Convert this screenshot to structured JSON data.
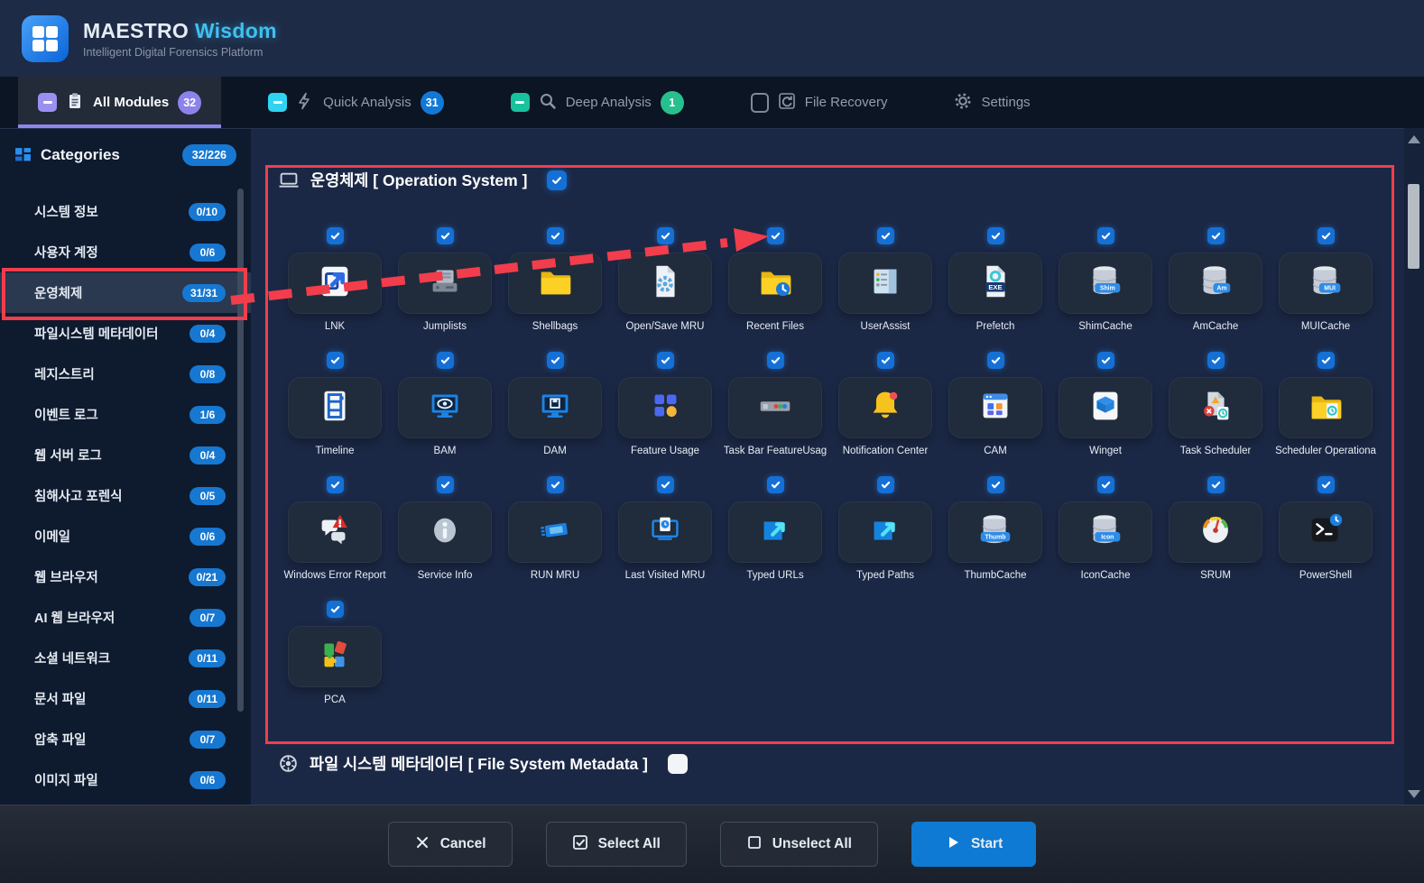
{
  "header": {
    "title_primary": "MAESTRO",
    "title_accent": "Wisdom",
    "subtitle": "Intelligent Digital Forensics Platform",
    "logo_icon": "grid-logo-icon"
  },
  "tabs": [
    {
      "label": "All Modules",
      "badge": "32",
      "badge_color": "#8d82ea",
      "state": "indeterminate",
      "state_color": "#9c8ff2",
      "icon": "clipboard-icon",
      "active": true
    },
    {
      "label": "Quick Analysis",
      "badge": "31",
      "badge_color": "#1278d8",
      "state": "indeterminate",
      "state_color": "#2fd4f2",
      "icon": "lightning-icon",
      "active": false
    },
    {
      "label": "Deep Analysis",
      "badge": "1",
      "badge_color": "#28bf8e",
      "state": "indeterminate",
      "state_color": "#19c29e",
      "icon": "search-icon",
      "active": false
    },
    {
      "label": "File Recovery",
      "badge": null,
      "state": "unchecked",
      "state_color": "#7e8a9c",
      "icon": "recovery-icon",
      "active": false
    },
    {
      "label": "Settings",
      "badge": null,
      "state": null,
      "state_color": null,
      "icon": "gear-icon",
      "active": false
    }
  ],
  "sidebar": {
    "title": "Categories",
    "badge": "32/226",
    "icon": "categories-grid-icon",
    "items": [
      {
        "label": "시스템 정보",
        "badge": "0/10",
        "selected": false
      },
      {
        "label": "사용자 계정",
        "badge": "0/6",
        "selected": false
      },
      {
        "label": "운영체제",
        "badge": "31/31",
        "selected": true
      },
      {
        "label": "파일시스템 메타데이터",
        "badge": "0/4",
        "selected": false
      },
      {
        "label": "레지스트리",
        "badge": "0/8",
        "selected": false
      },
      {
        "label": "이벤트 로그",
        "badge": "1/6",
        "selected": false
      },
      {
        "label": "웹 서버 로그",
        "badge": "0/4",
        "selected": false
      },
      {
        "label": "침해사고 포렌식",
        "badge": "0/5",
        "selected": false
      },
      {
        "label": "이메일",
        "badge": "0/6",
        "selected": false
      },
      {
        "label": "웹 브라우저",
        "badge": "0/21",
        "selected": false
      },
      {
        "label": "AI 웹 브라우저",
        "badge": "0/7",
        "selected": false
      },
      {
        "label": "소셜 네트워크",
        "badge": "0/11",
        "selected": false
      },
      {
        "label": "문서 파일",
        "badge": "0/11",
        "selected": false
      },
      {
        "label": "압축 파일",
        "badge": "0/7",
        "selected": false
      },
      {
        "label": "이미지 파일",
        "badge": "0/6",
        "selected": false
      }
    ]
  },
  "main": {
    "sections": [
      {
        "title": "운영체제 [ Operation System ]",
        "icon": "laptop-icon",
        "checked": true
      },
      {
        "title": "파일 시스템 메타데이터 [ File System Metadata ]",
        "icon": "metadata-gear-icon",
        "checked": false
      }
    ],
    "modules": [
      {
        "label": "LNK",
        "icon": "lnk-icon",
        "checked": true
      },
      {
        "label": "Jumplists",
        "icon": "drive-icon",
        "checked": true
      },
      {
        "label": "Shellbags",
        "icon": "folder-icon",
        "checked": true
      },
      {
        "label": "Open/Save MRU",
        "icon": "file-gear-icon",
        "checked": true
      },
      {
        "label": "Recent Files",
        "icon": "folder-clock-icon",
        "checked": true
      },
      {
        "label": "UserAssist",
        "icon": "list-window-icon",
        "checked": true
      },
      {
        "label": "Prefetch",
        "icon": "file-exe-icon",
        "checked": true
      },
      {
        "label": "ShimCache",
        "icon": "database-icon",
        "badge": "Shim",
        "checked": true
      },
      {
        "label": "AmCache",
        "icon": "database-icon",
        "badge": "Am",
        "checked": true
      },
      {
        "label": "MUICache",
        "icon": "database-icon",
        "badge": "MUI",
        "checked": true
      },
      {
        "label": "Timeline",
        "icon": "filmstrip-icon",
        "checked": true
      },
      {
        "label": "BAM",
        "icon": "monitor-eye-icon",
        "checked": true
      },
      {
        "label": "DAM",
        "icon": "monitor-save-icon",
        "checked": true
      },
      {
        "label": "Feature Usage",
        "icon": "shapes-icon",
        "checked": true
      },
      {
        "label": "Task Bar FeatureUsag",
        "icon": "taskbar-icon",
        "checked": true
      },
      {
        "label": "Notification Center",
        "icon": "bell-icon",
        "checked": true
      },
      {
        "label": "CAM",
        "icon": "window-grid-icon",
        "checked": true
      },
      {
        "label": "Winget",
        "icon": "box-icon",
        "checked": true
      },
      {
        "label": "Task Scheduler",
        "icon": "doc-warn-clock-icon",
        "checked": true
      },
      {
        "label": "Scheduler Operationa",
        "icon": "folder-doc-clock-icon",
        "checked": true
      },
      {
        "label": "Windows Error Report",
        "icon": "chat-warning-icon",
        "checked": true
      },
      {
        "label": "Service Info",
        "icon": "info-icon",
        "checked": true
      },
      {
        "label": "RUN MRU",
        "icon": "ticket-icon",
        "checked": true
      },
      {
        "label": "Last Visited MRU",
        "icon": "monitor-doc-icon",
        "checked": true
      },
      {
        "label": "Typed URLs",
        "icon": "arrow-square-icon",
        "checked": true
      },
      {
        "label": "Typed Paths",
        "icon": "arrow-square-icon",
        "checked": true
      },
      {
        "label": "ThumbCache",
        "icon": "database-icon",
        "badge": "Thumb",
        "checked": true
      },
      {
        "label": "IconCache",
        "icon": "database-icon",
        "badge": "Icon",
        "checked": true
      },
      {
        "label": "SRUM",
        "icon": "gauge-icon",
        "checked": true
      },
      {
        "label": "PowerShell",
        "icon": "powershell-icon",
        "checked": true
      },
      {
        "label": "PCA",
        "icon": "puzzle-icon",
        "checked": true
      }
    ]
  },
  "footer": {
    "buttons": [
      {
        "label": "Cancel",
        "icon": "close-icon",
        "primary": false
      },
      {
        "label": "Select All",
        "icon": "checkbox-checked-icon",
        "primary": false
      },
      {
        "label": "Unselect All",
        "icon": "checkbox-empty-icon",
        "primary": false
      },
      {
        "label": "Start",
        "icon": "play-icon",
        "primary": true
      }
    ]
  },
  "annotation": {
    "color": "#f23d4c",
    "note": "red boxes and dashed arrow highlight 운영체제 category selection"
  }
}
